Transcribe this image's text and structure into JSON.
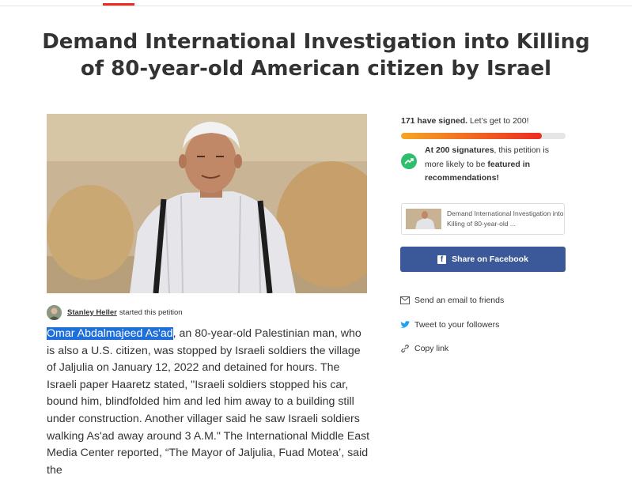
{
  "petition": {
    "title": "Demand International Investigation into Killing of 80-year-old American citizen by Israel",
    "starter_name": "Stanley Heller",
    "starter_suffix": "started this petition",
    "body_highlight": "Omar Abdalmajeed As'ad",
    "body_rest": ", an 80-year-old Palestinian man, who is also a U.S. citizen, was stopped by Israeli soldiers the village of Jaljulia on January 12, 2022 and detained for hours.  The Israeli paper Haaretz stated, \"Israeli soldiers stopped his car, bound him, blindfolded him and led him away to a building still under construction. Another villager said he saw Israeli soldiers walking As'ad away around 3 A.M.\"  The International Middle East Media Center reported, “The Mayor of Jaljulia, Fuad Motea’, said the"
  },
  "signatures": {
    "count_label": "171 have signed.",
    "goal_label": "Let’s get to 200!",
    "progress_fraction": 0.855,
    "milestone_prefix": "At 200 signatures",
    "milestone_middle": ", this petition is more likely to be ",
    "milestone_bold": "featured in recommendations!"
  },
  "share": {
    "card_text": "Demand International Investigation into Killing of 80-year-old ...",
    "facebook_label": "Share on Facebook",
    "email_label": "Send an email to friends",
    "twitter_label": "Tweet to your followers",
    "copy_label": "Copy link"
  },
  "colors": {
    "brand_red": "#ec2c22",
    "facebook_blue": "#3b5998",
    "twitter_blue": "#1da1f2",
    "milestone_green": "#2fbd6e",
    "selection_blue": "#1e6fd9"
  },
  "icons": [
    "trend-up-icon",
    "facebook-icon",
    "email-icon",
    "twitter-icon",
    "link-icon"
  ]
}
